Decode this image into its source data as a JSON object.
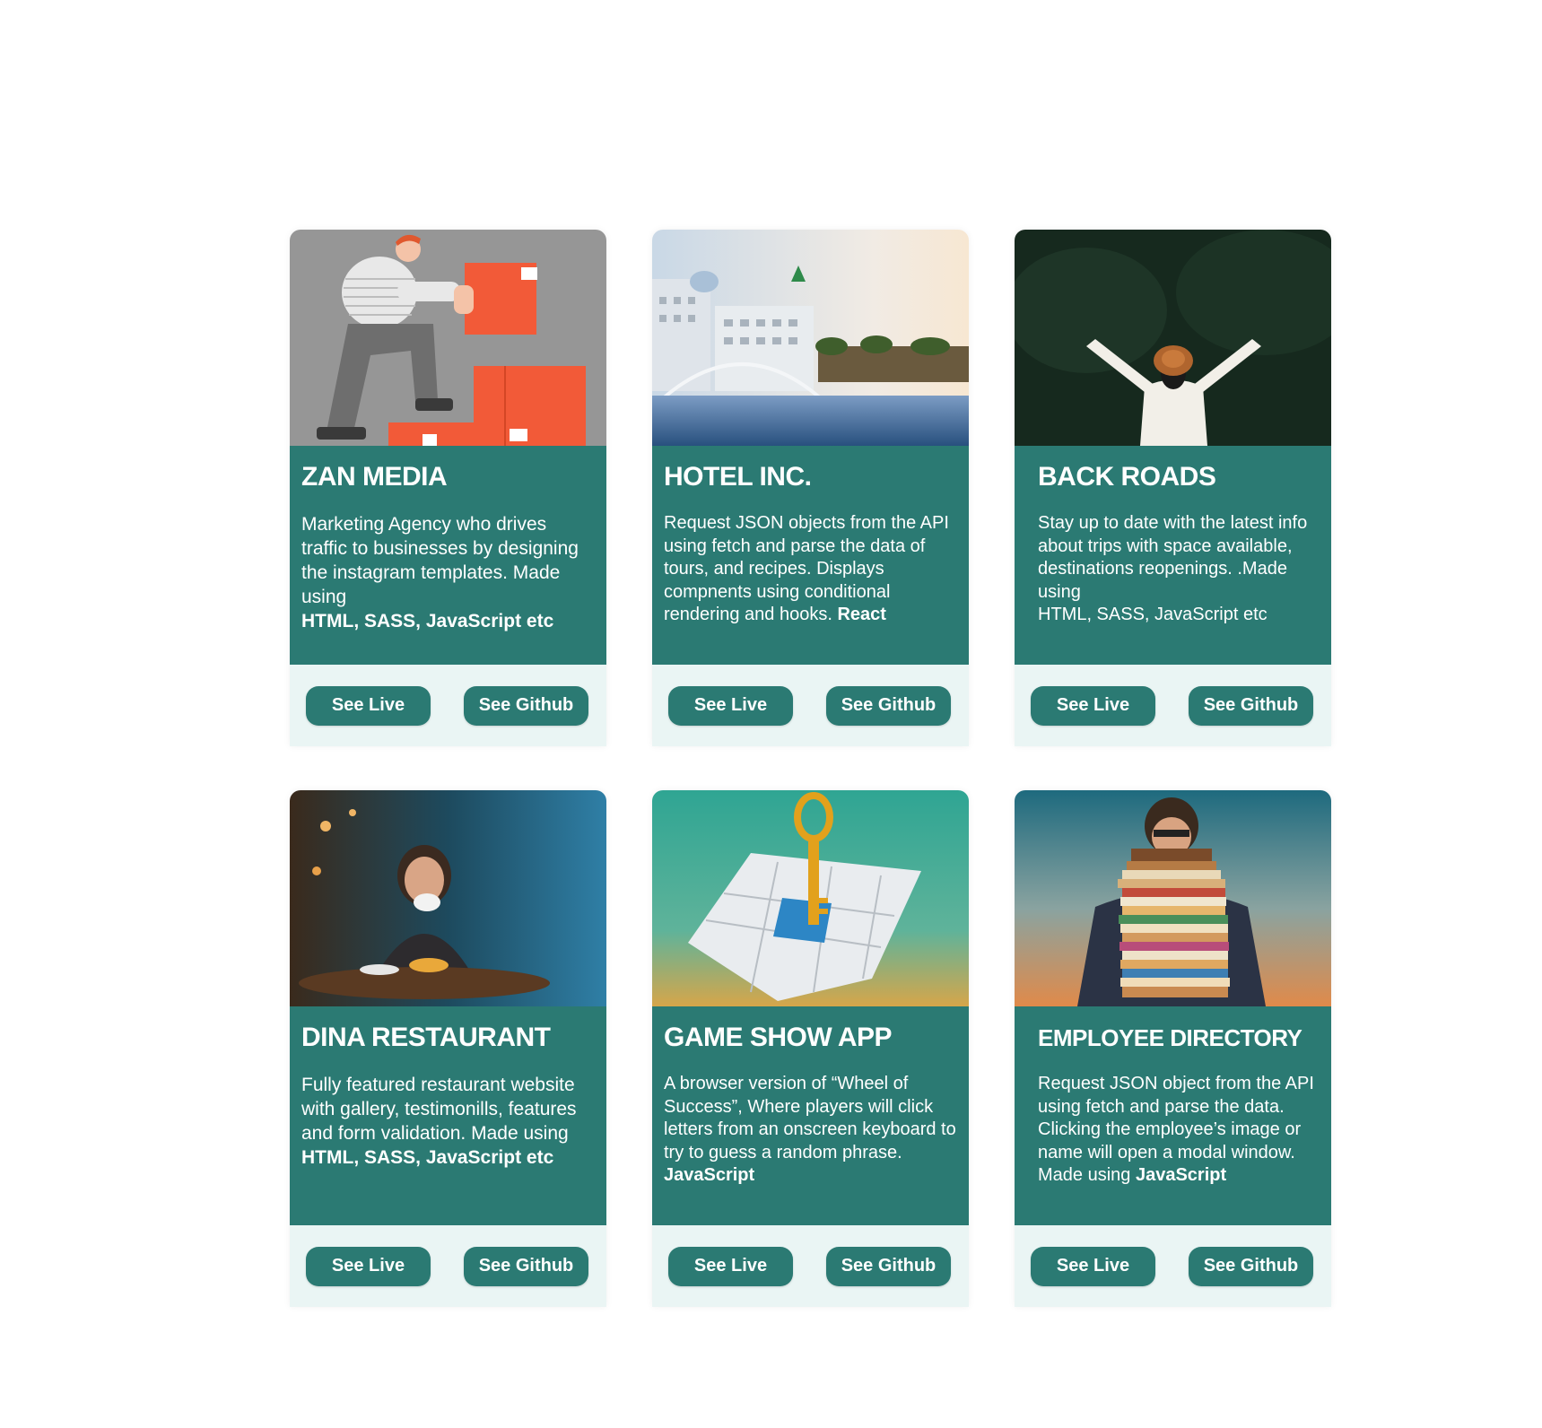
{
  "projects": [
    {
      "title": "ZAN MEDIA",
      "description": "Marketing Agency who drives traffic to businesses by designing the instagram templates. Made using",
      "tech": "HTML, SASS, JavaScript etc",
      "live_label": "See Live",
      "github_label": "See Github",
      "image_icon": "delivery-illustration-icon"
    },
    {
      "title": "HOTEL INC.",
      "description": "Request JSON objects from the API using fetch and parse the data of tours, and recipes. Displays compnents using conditional rendering and hooks.",
      "tech": "React",
      "live_label": "See Live",
      "github_label": "See Github",
      "image_icon": "hotel-photo-icon"
    },
    {
      "title": "BACK ROADS",
      "description": "Stay up to date with the latest info about trips with space available, destinations reopenings. .Made using",
      "tech": "HTML, SASS, JavaScript etc",
      "live_label": "See Live",
      "github_label": "See Github",
      "image_icon": "traveler-photo-icon"
    },
    {
      "title": "DINA RESTAURANT",
      "description": "Fully featured restaurant website with gallery, testimonills, features and form validation. Made using",
      "tech": "HTML, SASS, JavaScript etc",
      "live_label": "See Live",
      "github_label": "See Github",
      "image_icon": "cafe-photo-icon"
    },
    {
      "title": "GAME SHOW APP",
      "description": "A browser version of “Wheel of Success”, Where players will click letters from an onscreen keyboard to try to guess a random phrase.",
      "tech": "JavaScript",
      "live_label": "See Live",
      "github_label": "See Github",
      "image_icon": "puzzle-key-icon"
    },
    {
      "title": "EMPLOYEE DIRECTORY",
      "description": "Request JSON object from the API using fetch and parse the data. Clicking the employee’s image or name will open a modal window. Made using",
      "tech": "JavaScript",
      "live_label": "See Live",
      "github_label": "See Github",
      "image_icon": "paper-stack-photo-icon"
    }
  ],
  "colors": {
    "accent": "#2b7a73",
    "actions_bg": "#eaf5f4",
    "accent_text": "#ffffff"
  }
}
